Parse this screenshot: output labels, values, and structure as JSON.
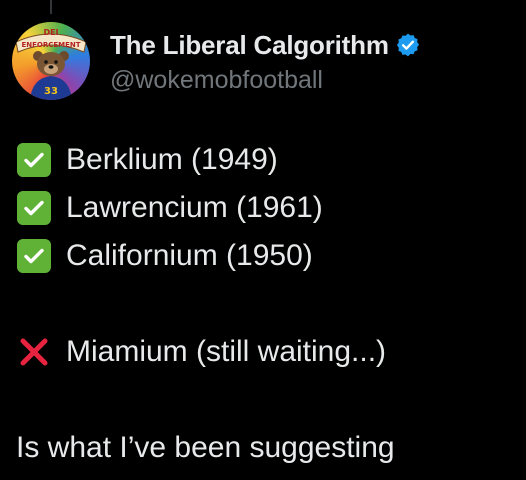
{
  "tweet": {
    "author": {
      "display_name": "The Liberal Calgorithm",
      "handle": "@wokemobfootball",
      "verified": true,
      "avatar_text_top": "DEI",
      "avatar_text_banner": "ENFORCEMENT",
      "avatar_jersey_number": "33"
    },
    "lines": [
      {
        "emoji": "check-mark-button-icon",
        "text": "Berklium (1949)"
      },
      {
        "emoji": "check-mark-button-icon",
        "text": "Lawrencium (1961)"
      },
      {
        "emoji": "check-mark-button-icon",
        "text": "Californium (1950)"
      },
      {
        "emoji": null,
        "text": ""
      },
      {
        "emoji": "cross-mark-icon",
        "text": "Miamium (still waiting...)"
      },
      {
        "emoji": null,
        "text": ""
      },
      {
        "emoji": null,
        "text": "Is what I’ve been suggesting"
      }
    ]
  },
  "colors": {
    "background": "#000000",
    "text_primary": "#e7e9ea",
    "text_secondary": "#71767b",
    "verified_blue": "#1d9bf0",
    "check_green": "#5fb236",
    "cross_red": "#e8233f"
  }
}
